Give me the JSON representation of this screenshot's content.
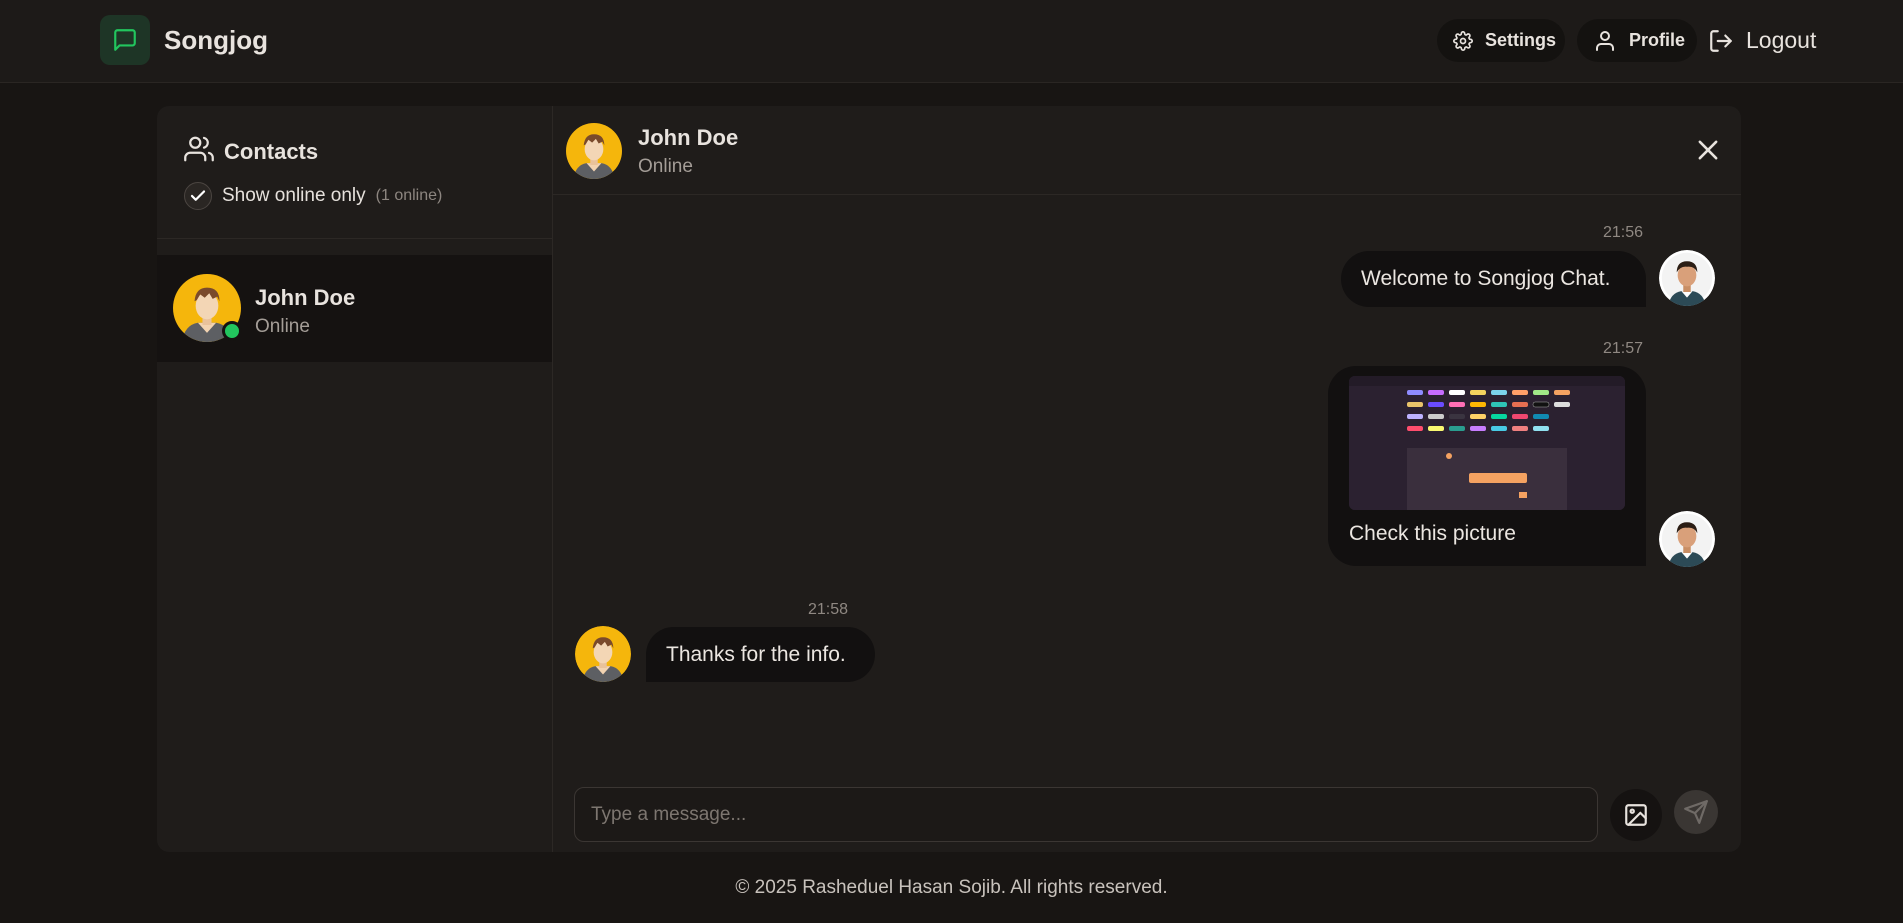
{
  "app": {
    "name": "Songjog",
    "accent": "#22c55e"
  },
  "nav": {
    "settings_label": "Settings",
    "profile_label": "Profile",
    "logout_label": "Logout"
  },
  "sidebar": {
    "title": "Contacts",
    "online_filter_label": "Show online only",
    "online_filter_checked": true,
    "online_count": "(1 online)",
    "contacts": [
      {
        "name": "John Doe",
        "status": "Online",
        "online": true
      }
    ]
  },
  "chat": {
    "contact_name": "John Doe",
    "contact_status": "Online",
    "messages": [
      {
        "direction": "out",
        "time": "21:56",
        "text": "Welcome to Songjog Chat."
      },
      {
        "direction": "out",
        "time": "21:57",
        "text": "Check this picture",
        "has_image": true
      },
      {
        "direction": "in",
        "time": "21:58",
        "text": "Thanks for the info."
      }
    ],
    "composer_placeholder": "Type a message..."
  },
  "footer": {
    "text": "© 2025 Rasheduel Hasan Sojib. All rights reserved."
  }
}
